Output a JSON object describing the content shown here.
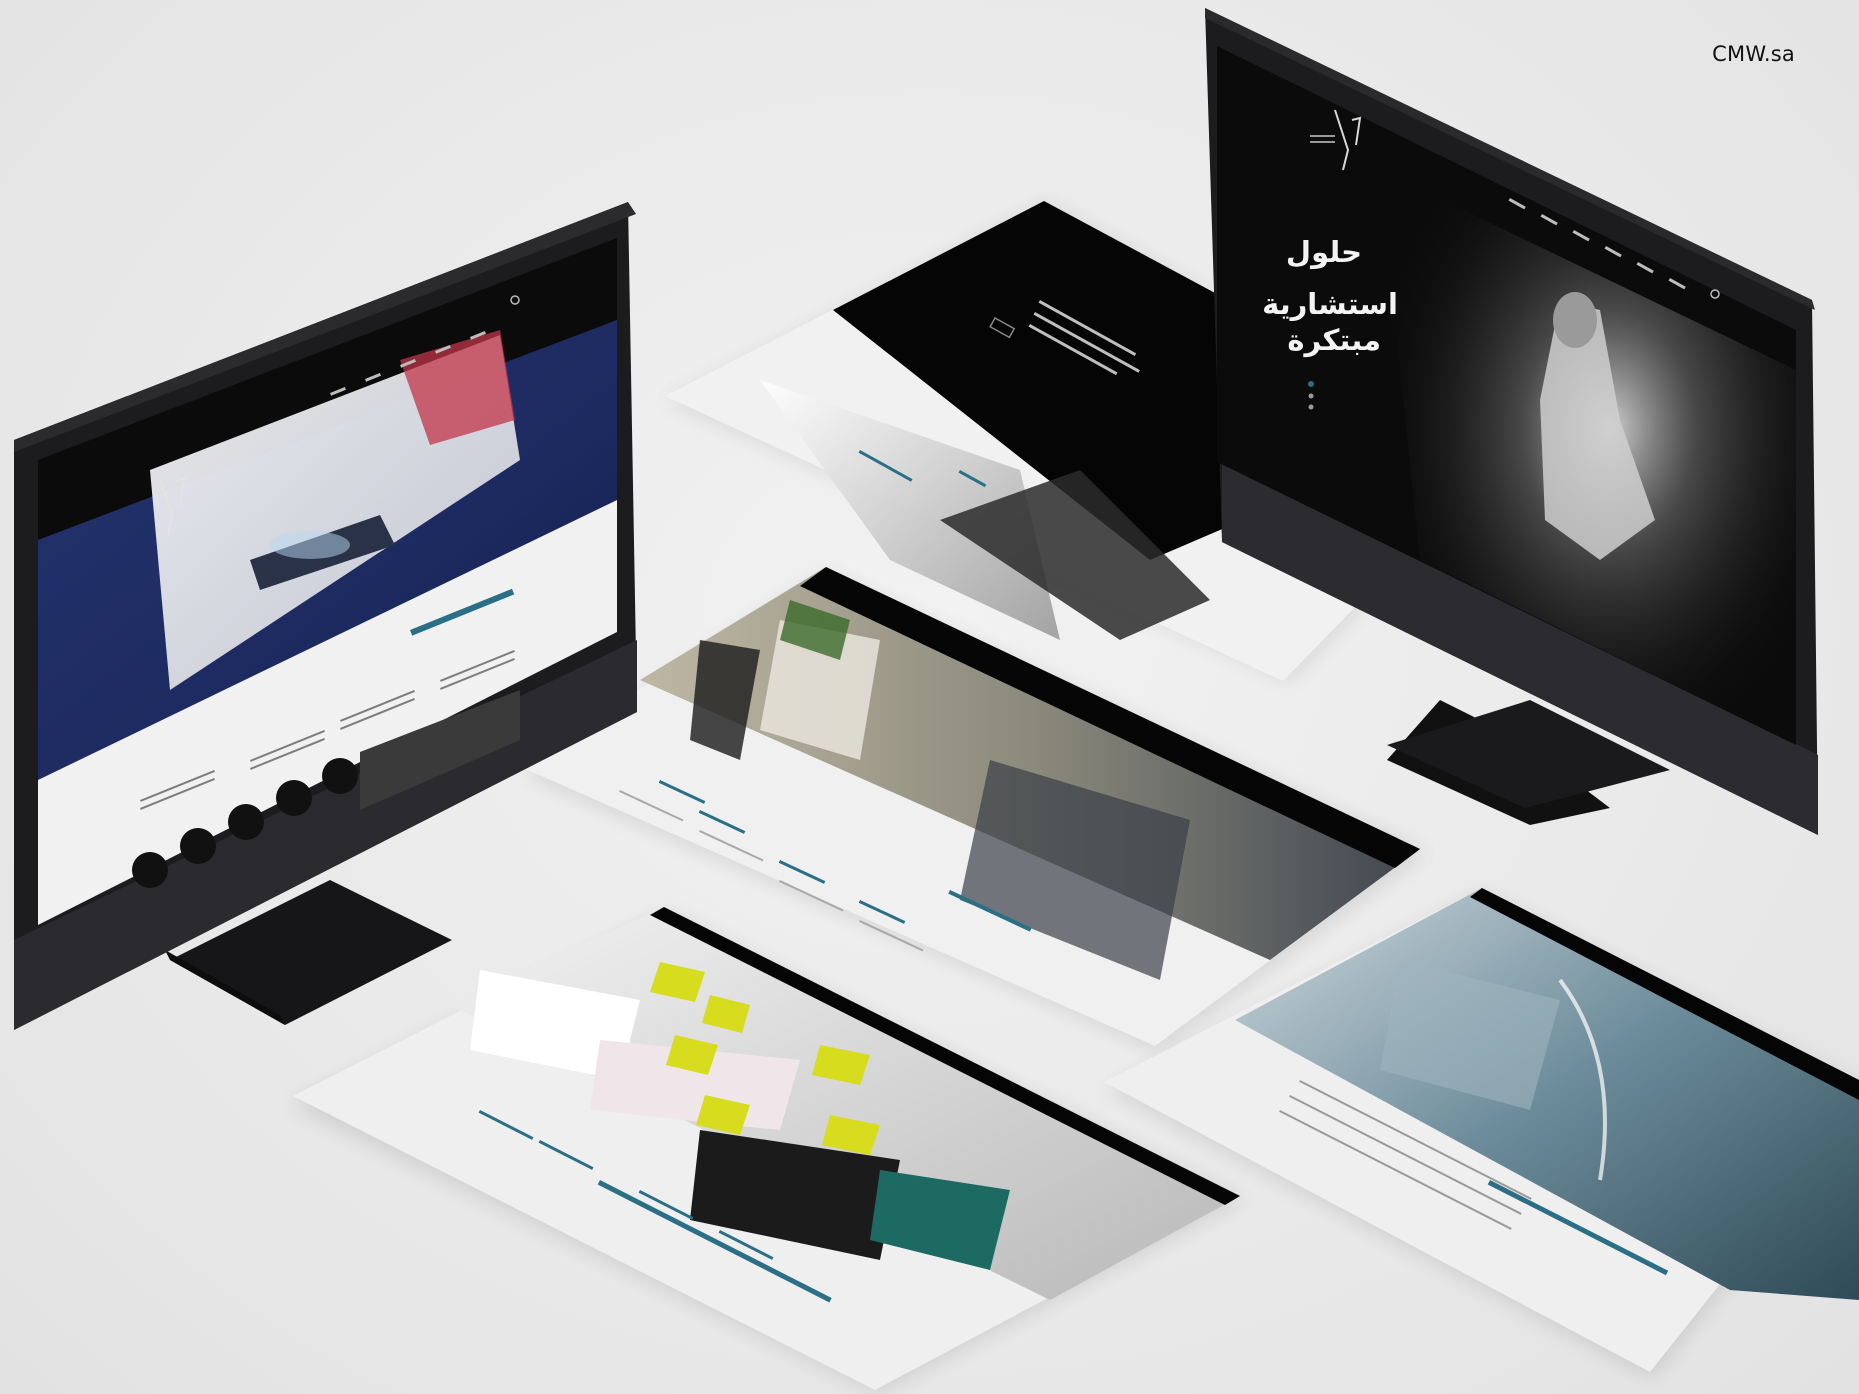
{
  "watermark": {
    "text": "CMW.sa"
  },
  "hero": {
    "line1": "حلول",
    "line2": "استشارية",
    "line3": "مبتكرة"
  },
  "colors": {
    "background": "#ececec",
    "monitor_body": "#1c1c1e",
    "screen_dark": "#0b0b0c",
    "accent_teal": "#2a6f86",
    "accent_yellow": "#d7dc1e",
    "navy_photo": "#1e2f6b",
    "glass_blue": "#5f8496"
  },
  "mockups": [
    {
      "kind": "monitor-left",
      "theme": "navy-photo-dark"
    },
    {
      "kind": "monitor-right",
      "theme": "dark-hero"
    },
    {
      "kind": "tilted-page-top",
      "theme": "dark-light-split"
    },
    {
      "kind": "tilted-page-center",
      "theme": "office-photo"
    },
    {
      "kind": "tilted-page-bottom-left",
      "theme": "team-sticky-notes"
    },
    {
      "kind": "tilted-page-bottom-right",
      "theme": "glass-building"
    }
  ]
}
